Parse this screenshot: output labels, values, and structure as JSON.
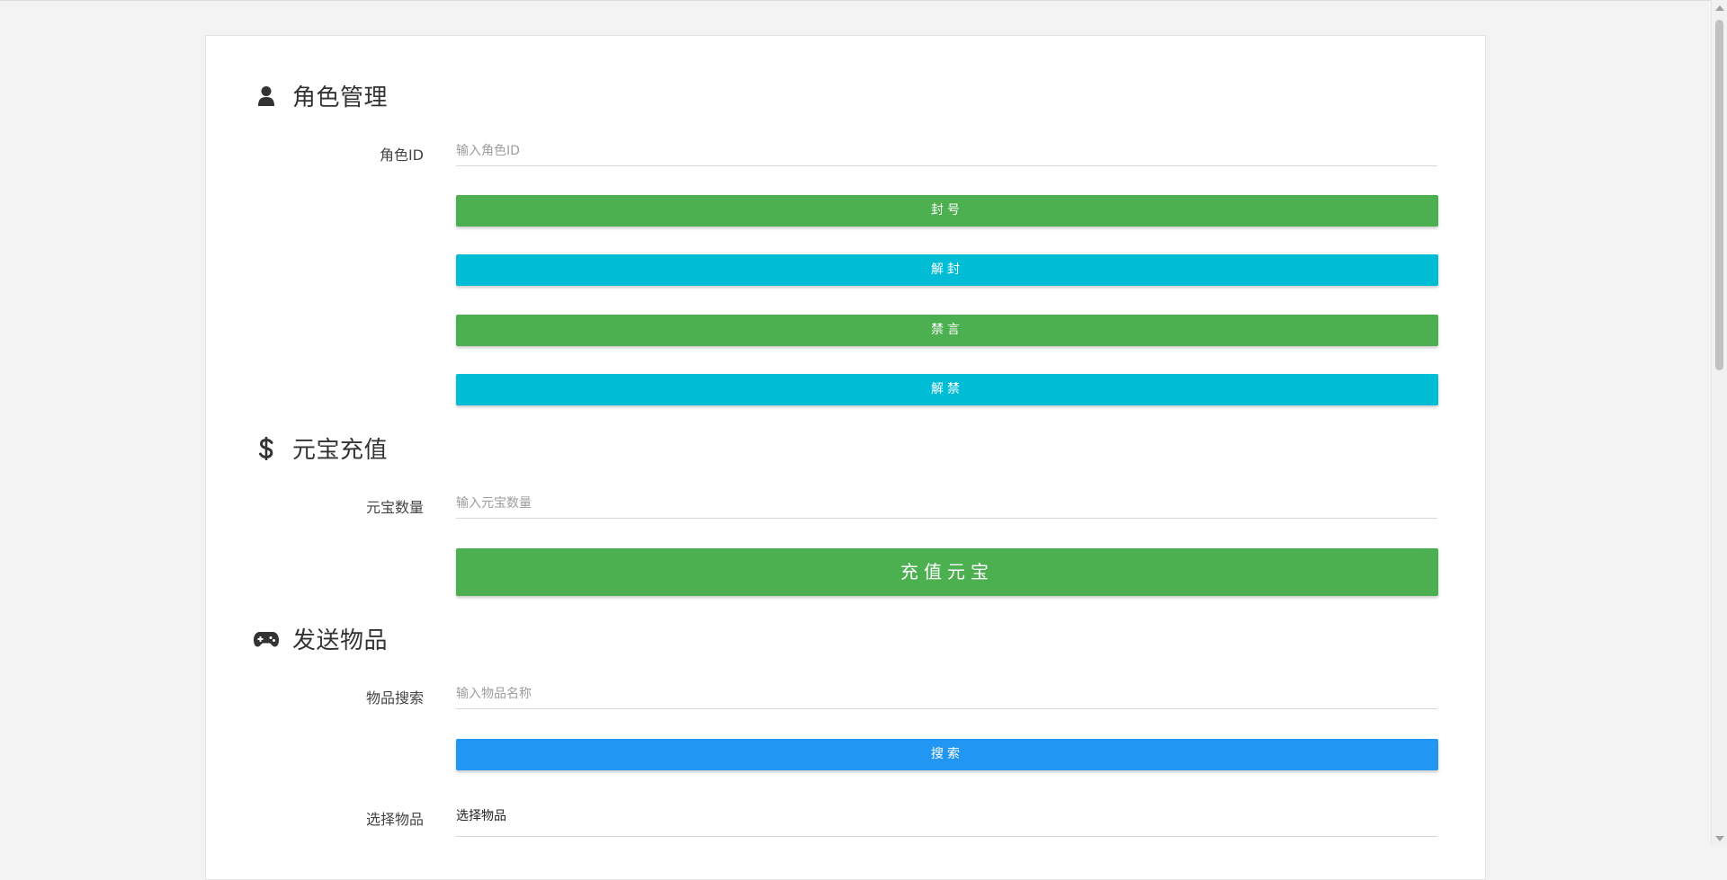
{
  "role_section": {
    "title": "角色管理",
    "icon": "user-icon",
    "role_id_label": "角色ID",
    "role_id_placeholder": "输入角色ID",
    "role_id_value": "",
    "ban_button": "封号",
    "unban_button": "解封",
    "mute_button": "禁言",
    "unmute_button": "解禁"
  },
  "yuanbao_section": {
    "title": "元宝充值",
    "icon": "dollar-icon",
    "amount_label": "元宝数量",
    "amount_placeholder": "输入元宝数量",
    "amount_value": "",
    "recharge_button": "充值元宝"
  },
  "items_section": {
    "title": "发送物品",
    "icon": "gamepad-icon",
    "search_label": "物品搜索",
    "search_placeholder": "输入物品名称",
    "search_value": "",
    "search_button": "搜索",
    "select_label": "选择物品",
    "select_value": "选择物品"
  },
  "colors": {
    "green": "#4caf50",
    "cyan": "#00bcd4",
    "blue": "#2196f3"
  }
}
